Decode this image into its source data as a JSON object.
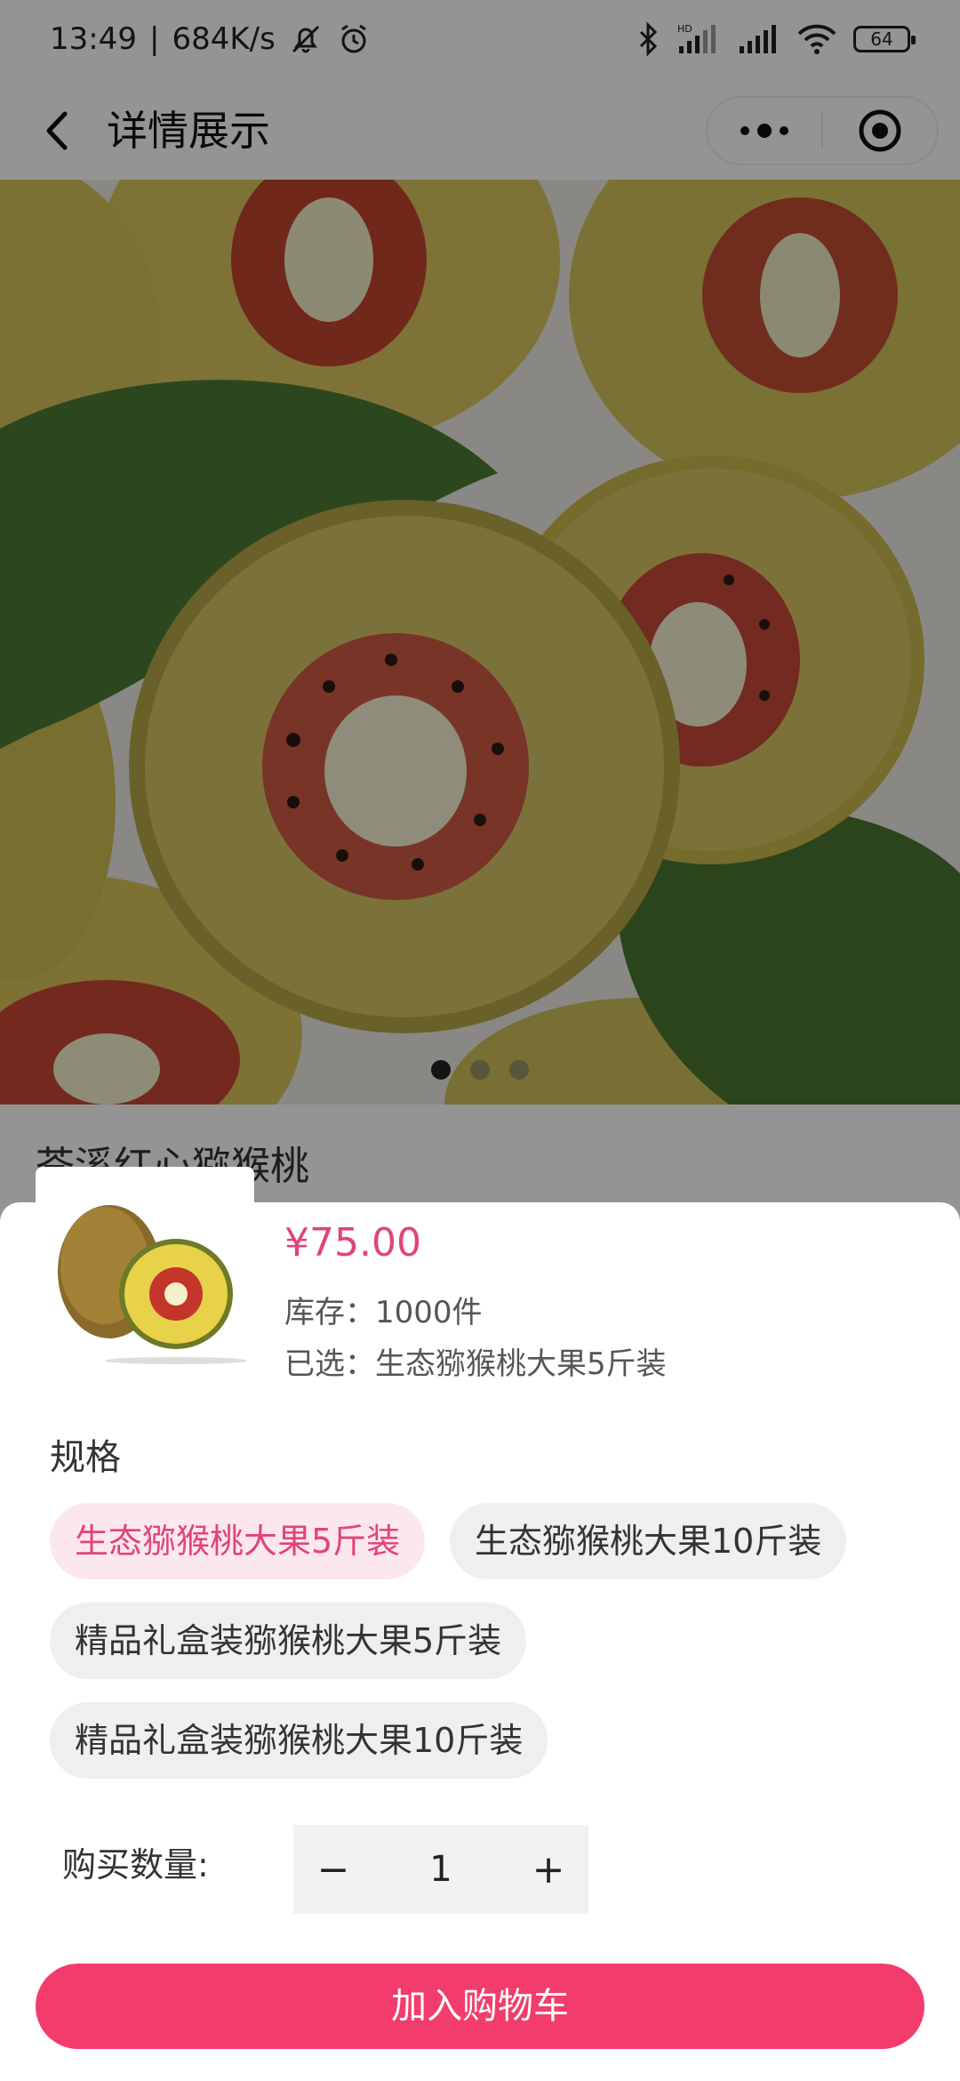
{
  "status_bar": {
    "time": "13:49",
    "speed": "684K/s",
    "battery": "64",
    "icons": [
      "mute-icon",
      "alarm-icon",
      "bluetooth-icon",
      "hd-signal-icon",
      "signal-icon",
      "wifi-icon",
      "battery-icon"
    ]
  },
  "nav": {
    "title": "详情展示"
  },
  "product": {
    "title": "苍溪红心猕猴桃",
    "image_count": 3,
    "active_image": 1
  },
  "sheet": {
    "price": "¥75.00",
    "stock": "库存：1000件",
    "selected": "已选：生态猕猴桃大果5斤装",
    "spec_title": "规格",
    "specs": [
      {
        "label": "生态猕猴桃大果5斤装",
        "active": true
      },
      {
        "label": "生态猕猴桃大果10斤装",
        "active": false
      },
      {
        "label": "精品礼盒装猕猴桃大果5斤装",
        "active": false
      },
      {
        "label": "精品礼盒装猕猴桃大果10斤装",
        "active": false
      }
    ],
    "qty_label": "购买数量:",
    "minus": "−",
    "qty": "1",
    "plus": "+",
    "add_cart": "加入购物车"
  },
  "colors": {
    "accent": "#e0447a",
    "button": "#f23d6c",
    "active_spec_bg": "#fde7ee"
  }
}
